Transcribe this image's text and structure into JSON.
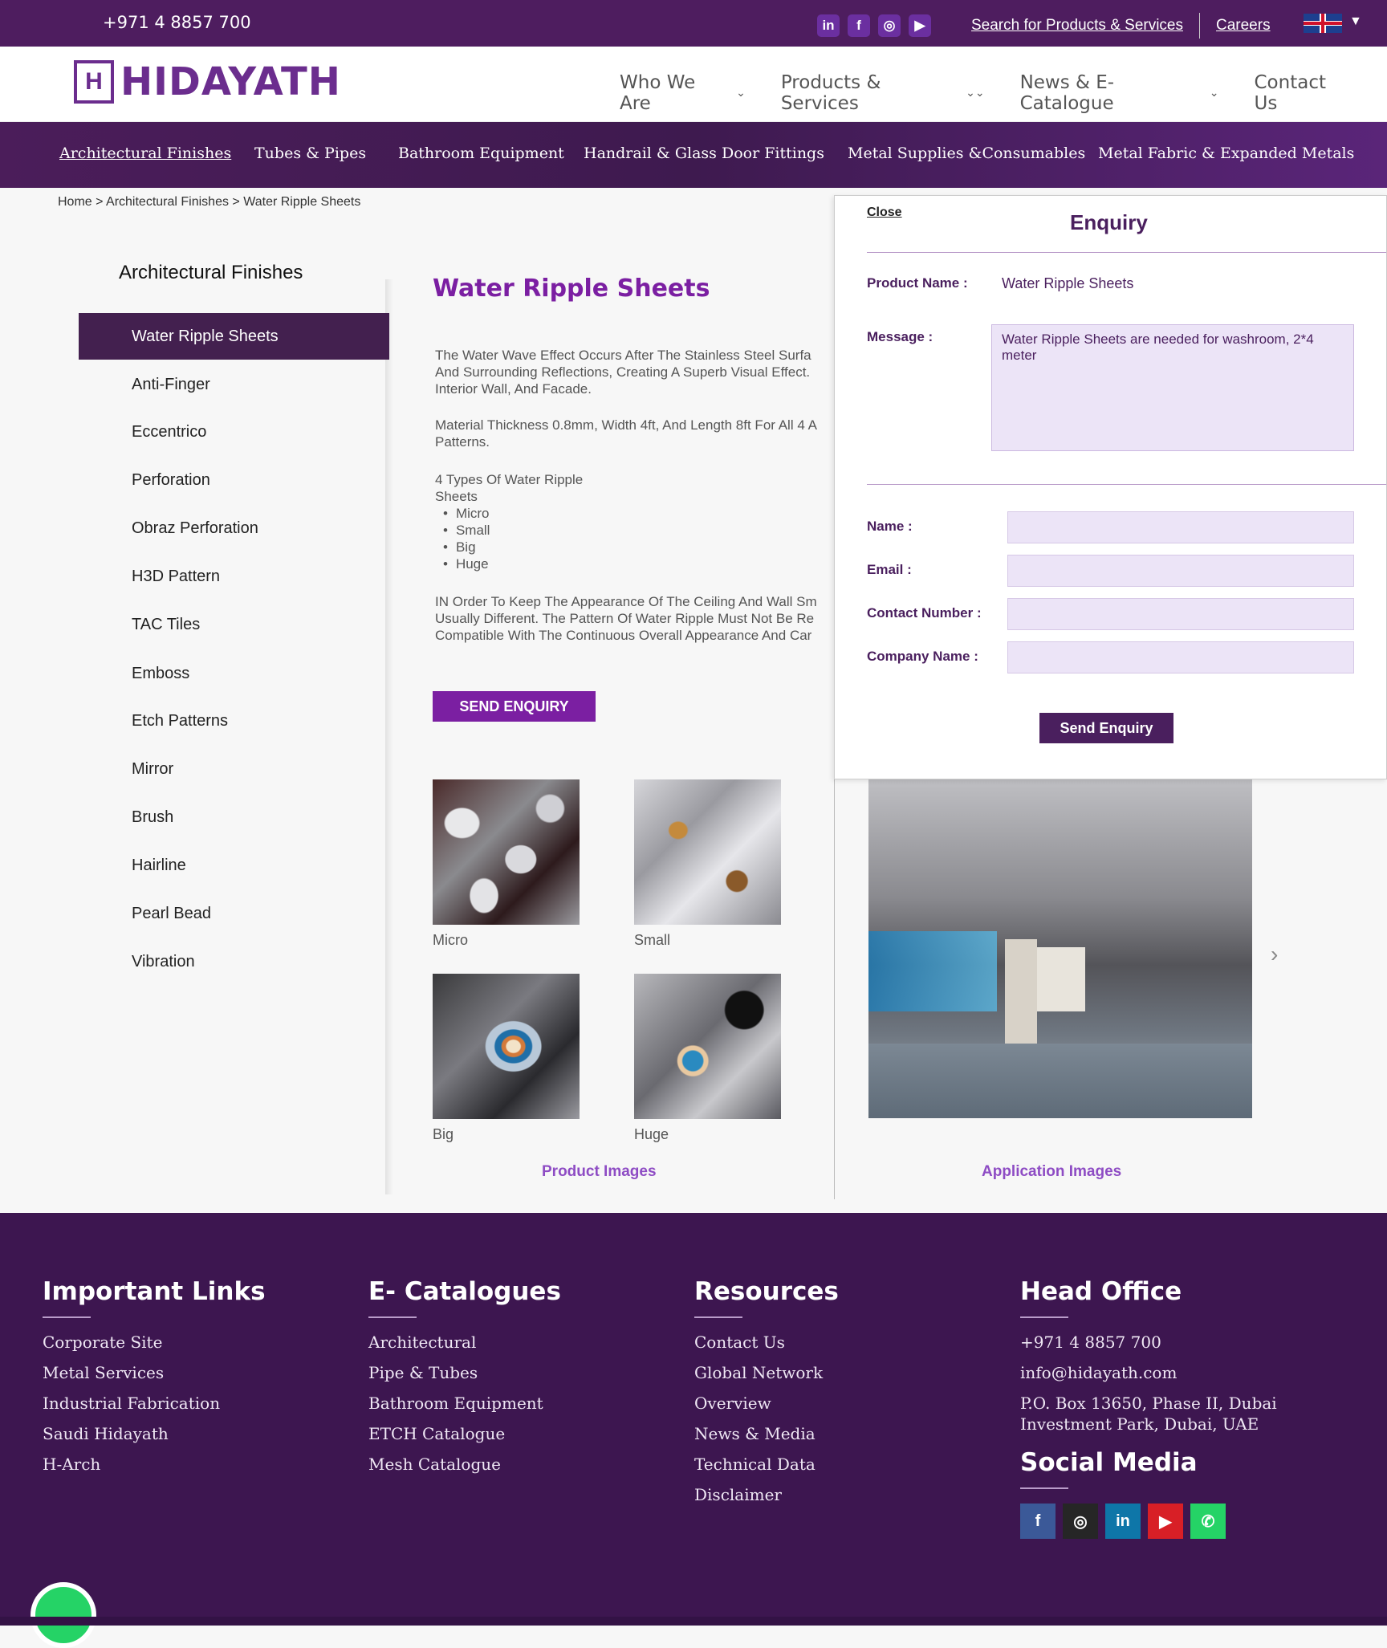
{
  "topbar": {
    "phone": "+971 4 8857 700",
    "social_icons": [
      "linkedin-icon",
      "facebook-icon",
      "instagram-icon",
      "youtube-icon"
    ],
    "search_link": "Search for Products & Services",
    "careers_link": "Careers",
    "language": "uk-flag-icon"
  },
  "header": {
    "logo_text": "HIDAYATH",
    "nav": [
      {
        "label": "Who We Are"
      },
      {
        "label": "Products & Services"
      },
      {
        "label": "News & E-Catalogue"
      },
      {
        "label": "Contact Us"
      }
    ]
  },
  "categories": [
    "Architectural Finishes",
    "Tubes & Pipes",
    "Bathroom Equipment",
    "Handrail & Glass Door Fittings",
    "Metal Supplies &Consumables",
    "Metal Fabric & Expanded Metals"
  ],
  "breadcrumb": "Home > Architectural Finishes > Water Ripple Sheets",
  "sidebar": {
    "title": "Architectural Finishes",
    "items": [
      "Water Ripple Sheets",
      "Anti-Finger",
      "Eccentrico",
      "Perforation",
      "Obraz Perforation",
      "H3D Pattern",
      "TAC Tiles",
      "Emboss",
      "Etch Patterns",
      "Mirror",
      "Brush",
      "Hairline",
      "Pearl Bead",
      "Vibration"
    ]
  },
  "product": {
    "title": "Water Ripple Sheets",
    "desc_lines_1": [
      "The Water Wave Effect Occurs After The Stainless Steel Surfa",
      "And Surrounding Reflections, Creating A Superb Visual Effect.",
      "Interior Wall, And Facade."
    ],
    "desc_lines_2": [
      "Material Thickness 0.8mm, Width 4ft, And Length 8ft For All 4 A",
      "Patterns."
    ],
    "types_heading_1": "4 Types Of Water Ripple",
    "types_heading_2": "Sheets",
    "types": [
      "Micro",
      "Small",
      "Big",
      "Huge"
    ],
    "desc_lines_3": [
      "IN Order To Keep The Appearance Of The Ceiling And Wall Sm",
      "Usually Different. The Pattern Of Water Ripple Must Not Be Re",
      "Compatible With The Continuous Overall Appearance And Car"
    ],
    "send_enquiry": "SEND ENQUIRY",
    "thumb_captions": [
      "Micro",
      "Small",
      "Big",
      "Huge"
    ],
    "product_images_caption": "Product Images",
    "application_images_caption": "Application Images"
  },
  "enquiry": {
    "close": "Close",
    "title": "Enquiry",
    "product_name_label": "Product Name :",
    "product_name_value": "Water Ripple Sheets",
    "message_label": "Message :",
    "message_value": "Water Ripple Sheets are needed for washroom, 2*4 meter",
    "name_label": "Name :",
    "email_label": "Email :",
    "contact_label": "Contact Number :",
    "company_label": "Company Name :",
    "send_button": "Send Enquiry"
  },
  "footer": {
    "important_links": {
      "title": "Important Links",
      "items": [
        "Corporate Site",
        "Metal Services",
        "Industrial Fabrication",
        "Saudi Hidayath",
        "H-Arch"
      ]
    },
    "catalogues": {
      "title": "E- Catalogues",
      "items": [
        "Architectural",
        "Pipe & Tubes",
        "Bathroom Equipment",
        "ETCH Catalogue",
        "Mesh Catalogue"
      ]
    },
    "resources": {
      "title": "Resources",
      "items": [
        "Contact Us",
        "Global Network",
        "Overview",
        "News & Media",
        "Technical Data",
        "Disclaimer"
      ]
    },
    "head_office": {
      "title": "Head Office",
      "phone": "+971 4 8857 700",
      "email": "info@hidayath.com",
      "address_1": "P.O. Box 13650, Phase II, Dubai",
      "address_2": "Investment Park, Dubai, UAE"
    },
    "social_title": "Social Media",
    "social_icons": [
      "facebook-icon",
      "instagram-icon",
      "linkedin-icon",
      "youtube-icon",
      "whatsapp-icon"
    ],
    "social_colors": [
      "#3b5998",
      "#262626",
      "#0e76a8",
      "#d81f26",
      "#25d366"
    ]
  }
}
